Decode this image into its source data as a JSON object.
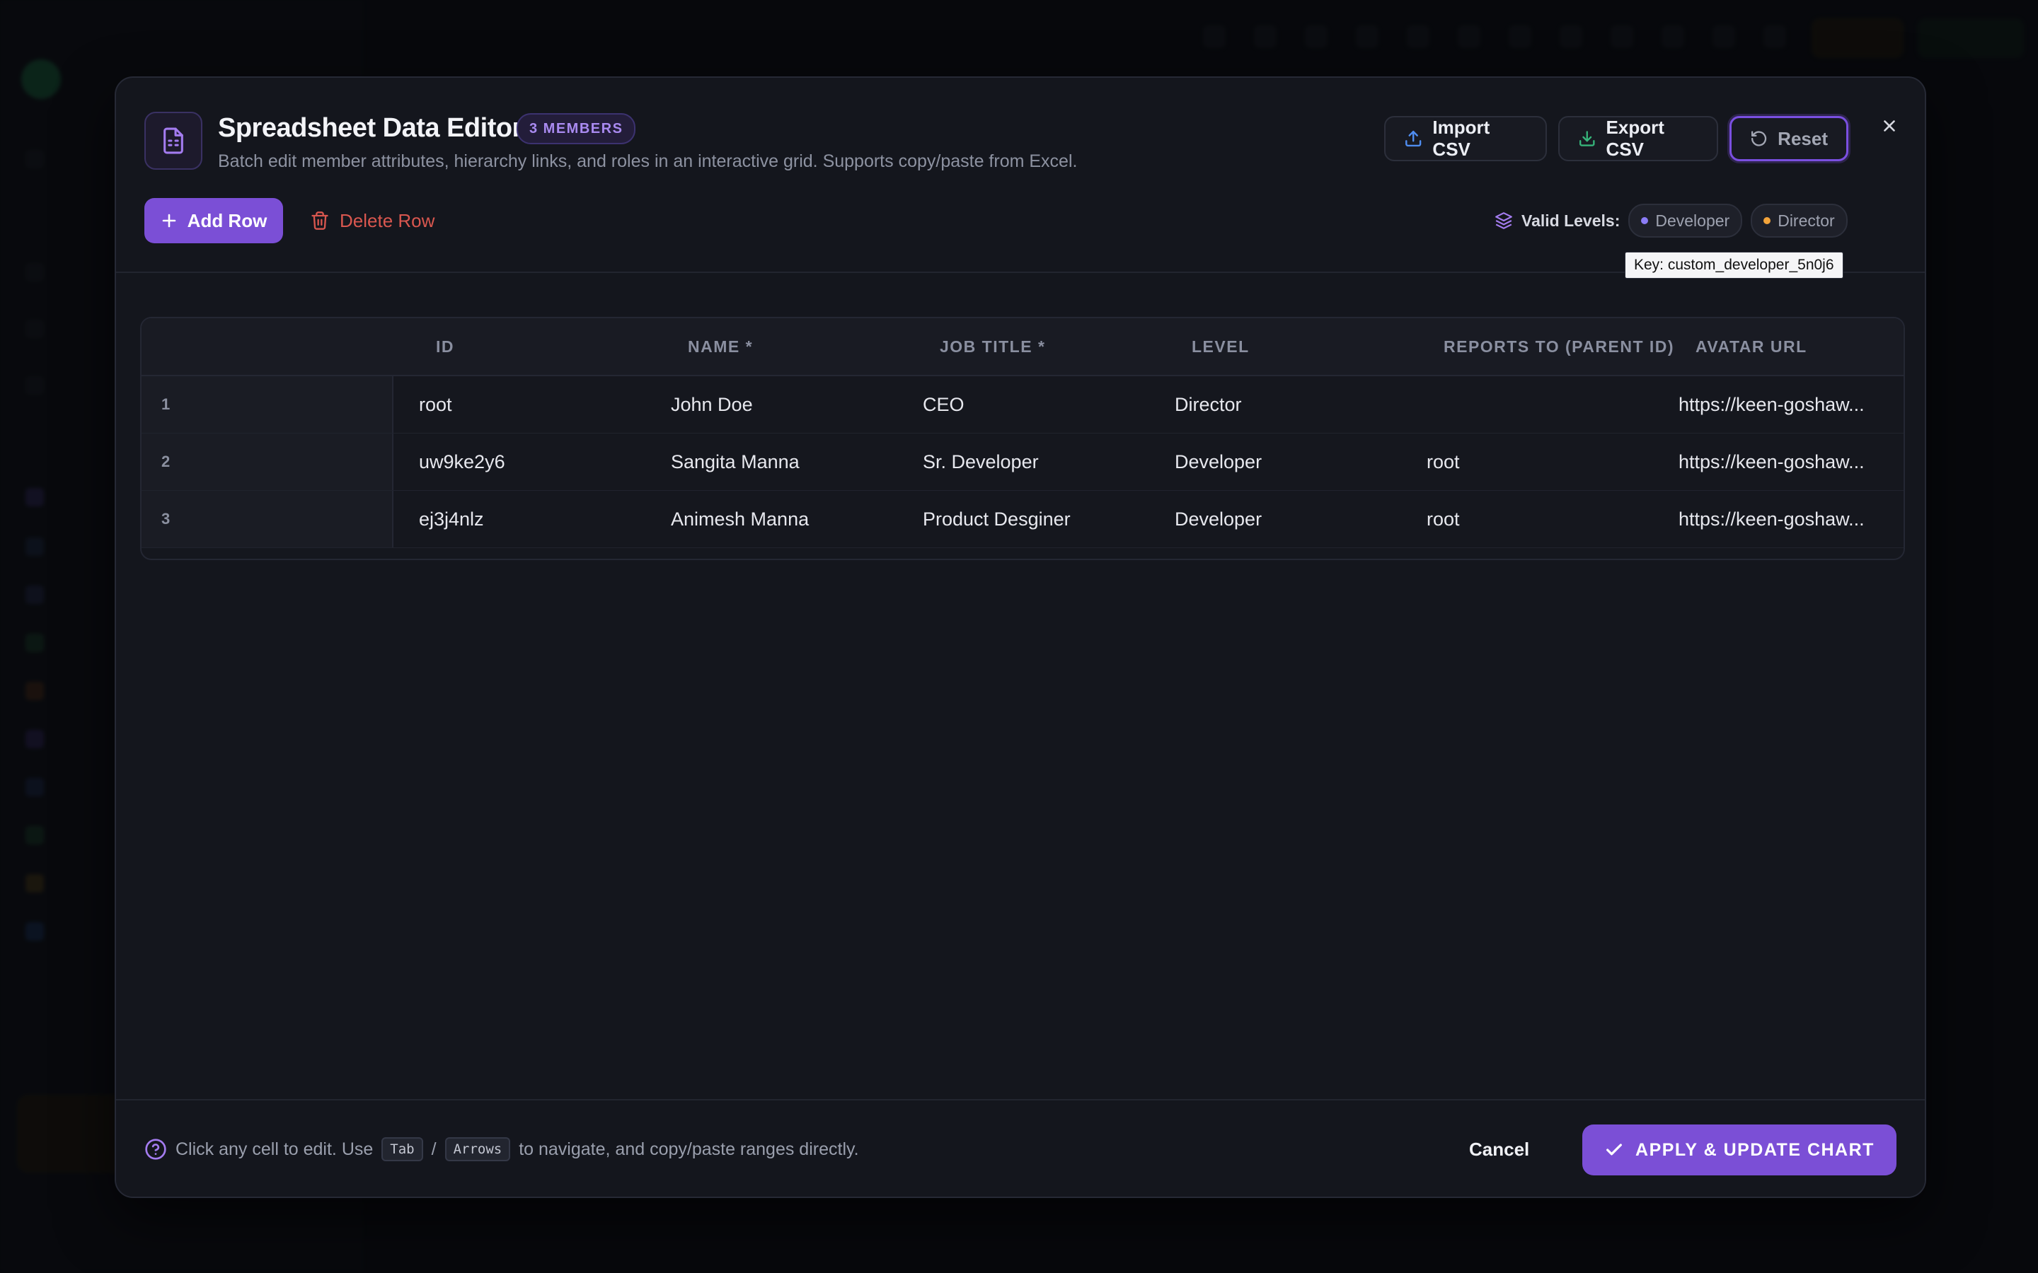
{
  "modal": {
    "title": "Spreadsheet Data Editor",
    "members_badge": "3 MEMBERS",
    "subtitle": "Batch edit member attributes, hierarchy links, and roles in an interactive grid. Supports copy/paste from Excel.",
    "import_label": "Import CSV",
    "export_label": "Export CSV",
    "reset_label": "Reset",
    "add_row_label": "Add Row",
    "delete_row_label": "Delete Row",
    "valid_levels_label": "Valid Levels:",
    "levels": [
      {
        "label": "Developer",
        "color": "#8b7cf6"
      },
      {
        "label": "Director",
        "color": "#f2a33a"
      }
    ],
    "tooltip": "Key: custom_developer_5n0j6"
  },
  "grid": {
    "columns": [
      "ID",
      "NAME *",
      "JOB TITLE *",
      "LEVEL",
      "REPORTS TO (PARENT ID)",
      "AVATAR URL"
    ],
    "rows": [
      {
        "num": "1",
        "id": "root",
        "name": "John Doe",
        "job_title": "CEO",
        "level": "Director",
        "reports_to": "",
        "avatar_url": "https://keen-goshaw..."
      },
      {
        "num": "2",
        "id": "uw9ke2y6",
        "name": "Sangita Manna",
        "job_title": "Sr. Developer",
        "level": "Developer",
        "reports_to": "root",
        "avatar_url": "https://keen-goshaw..."
      },
      {
        "num": "3",
        "id": "ej3j4nlz",
        "name": "Animesh Manna",
        "job_title": "Product Desginer",
        "level": "Developer",
        "reports_to": "root",
        "avatar_url": "https://keen-goshaw..."
      }
    ]
  },
  "footer": {
    "help_prefix": "Click any cell to edit. Use",
    "key_tab": "Tab",
    "separator": "/",
    "key_arrows": "Arrows",
    "help_suffix": "to navigate, and copy/paste ranges directly.",
    "cancel_label": "Cancel",
    "apply_label": "APPLY & UPDATE CHART"
  },
  "theme": {
    "accent": "#7b4fd6",
    "danger": "#d9574f",
    "background": "#14161d"
  }
}
